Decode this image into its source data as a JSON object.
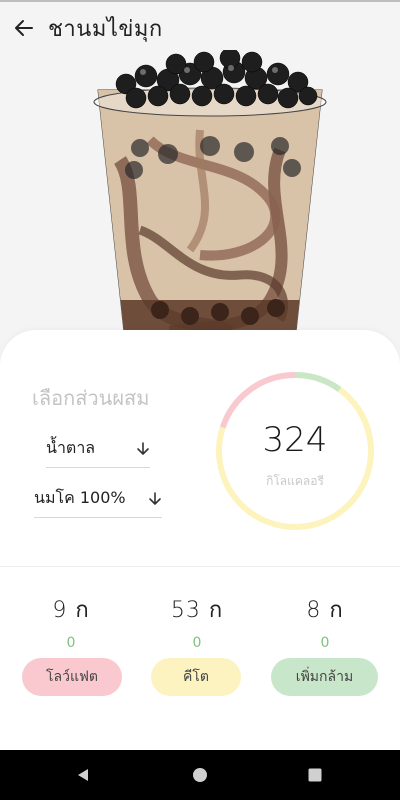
{
  "app_bar": {
    "title": "ชานมไข่มุก",
    "back_icon": "arrow-left-icon"
  },
  "hero": {
    "icon": "bubble-tea-illustration"
  },
  "mix": {
    "heading": "เลือกส่วนผสม",
    "sugar": {
      "value": "น้ำตาล"
    },
    "milk": {
      "value": "นมโค 100%"
    },
    "dropdown_icon": "arrow-down-icon"
  },
  "calories": {
    "value": "324",
    "unit": "กิโลแคลอรี",
    "ring_segments": [
      {
        "color": "#f8c9cf",
        "fraction": 0.2
      },
      {
        "color": "#c9e7c5",
        "fraction": 0.1
      },
      {
        "color": "#fdf3bd",
        "fraction": 0.7
      }
    ]
  },
  "macros": [
    {
      "amount": "9 ก",
      "sub": "0"
    },
    {
      "amount": "53 ก",
      "sub": "0"
    },
    {
      "amount": "8 ก",
      "sub": "0"
    }
  ],
  "tags": [
    {
      "label": "โลว์แฟต",
      "color": "#f9c9cf"
    },
    {
      "label": "คีโต",
      "color": "#fdf3c0"
    },
    {
      "label": "เพิ่มกล้าม",
      "color": "#c8e6c9"
    }
  ],
  "nav": {
    "back_icon": "nav-back-triangle-icon",
    "home_icon": "nav-home-circle-icon",
    "recents_icon": "nav-recents-square-icon"
  }
}
